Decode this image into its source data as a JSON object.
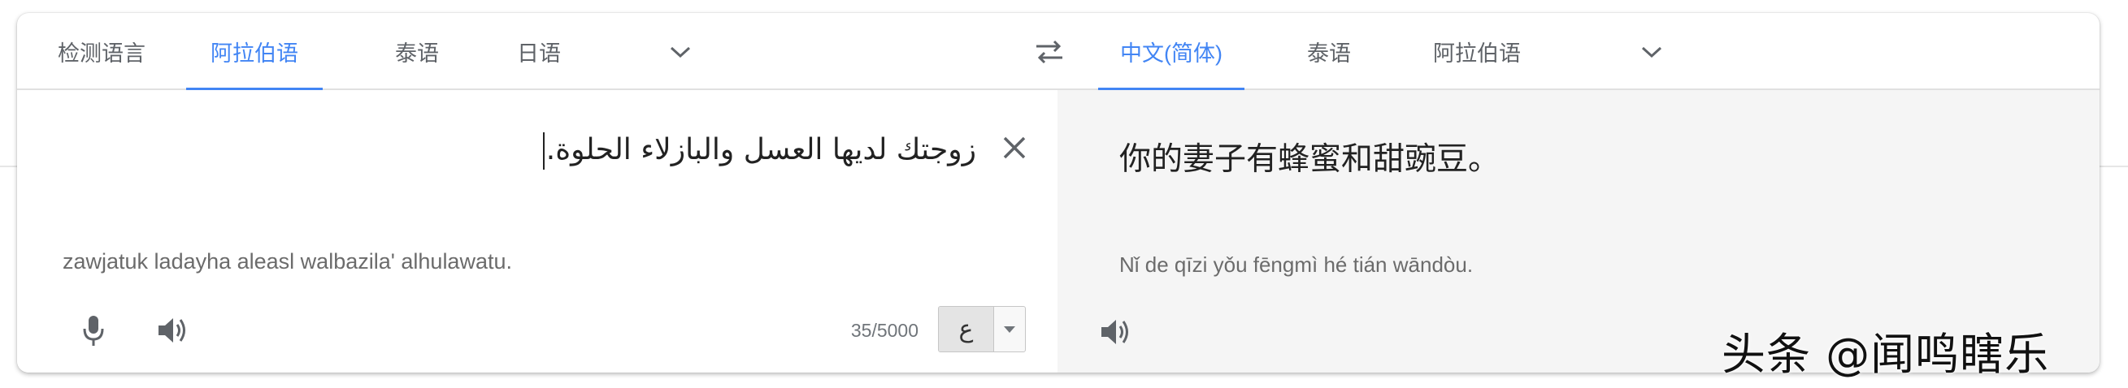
{
  "source_langs": {
    "detect": "检测语言",
    "arabic": "阿拉伯语",
    "thai": "泰语",
    "japanese": "日语"
  },
  "target_langs": {
    "chinese_simplified": "中文(简体)",
    "thai": "泰语",
    "arabic": "阿拉伯语"
  },
  "source": {
    "text": "زوجتك لديها العسل والبازلاء الحلوة.",
    "transliteration": "zawjatuk ladayha aleasl walbazila' alhulawatu.",
    "char_count": "35/5000",
    "ime_char": "ع"
  },
  "target": {
    "text": "你的妻子有蜂蜜和甜豌豆。",
    "pinyin": "Nǐ de qīzi yǒu fēngmì hé tián wāndòu."
  },
  "watermark": "头条 @闻鸣瞎乐",
  "colors": {
    "accent": "#4285f4",
    "tab_text": "#5f6368",
    "target_bg": "#f5f5f5"
  },
  "icons": [
    "chevron-down-icon",
    "swap-icon",
    "close-icon",
    "microphone-icon",
    "speaker-icon",
    "dropdown-arrow-icon"
  ]
}
